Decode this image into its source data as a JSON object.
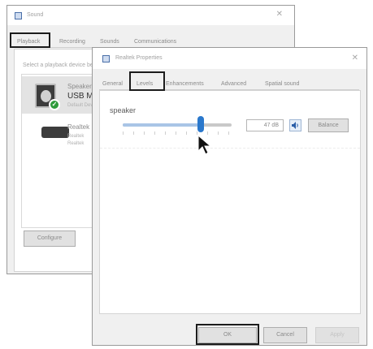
{
  "sound_window": {
    "title": "Sound",
    "tabs": [
      "Playback",
      "Recording",
      "Sounds",
      "Communications"
    ],
    "instruction": "Select a playback device below to modify its settings:",
    "devices": [
      {
        "name": "Speaker",
        "subtitle": "USB M",
        "status": "Default Device"
      },
      {
        "name": "Realtek",
        "line1": "Realtek",
        "line2": "Realtek"
      }
    ],
    "configure_label": "Configure"
  },
  "props_window": {
    "title": "Realtek Properties",
    "tabs": [
      "General",
      "Levels",
      "Enhancements",
      "Advanced",
      "Spatial sound"
    ],
    "level_label": "speaker",
    "level_value_text": "47 dB",
    "slider_level": 0.72,
    "balance_label": "Balance",
    "ok_label": "OK",
    "cancel_label": "Cancel",
    "apply_label": "Apply"
  },
  "colors": {
    "accent": "#2a78cc",
    "status_ok": "#2e9b3b",
    "highlight_box": "#1c1c1c"
  },
  "icons": {
    "cursor": "arrow-pointer",
    "mute": "speaker-icon",
    "default_device": "check-badge"
  }
}
